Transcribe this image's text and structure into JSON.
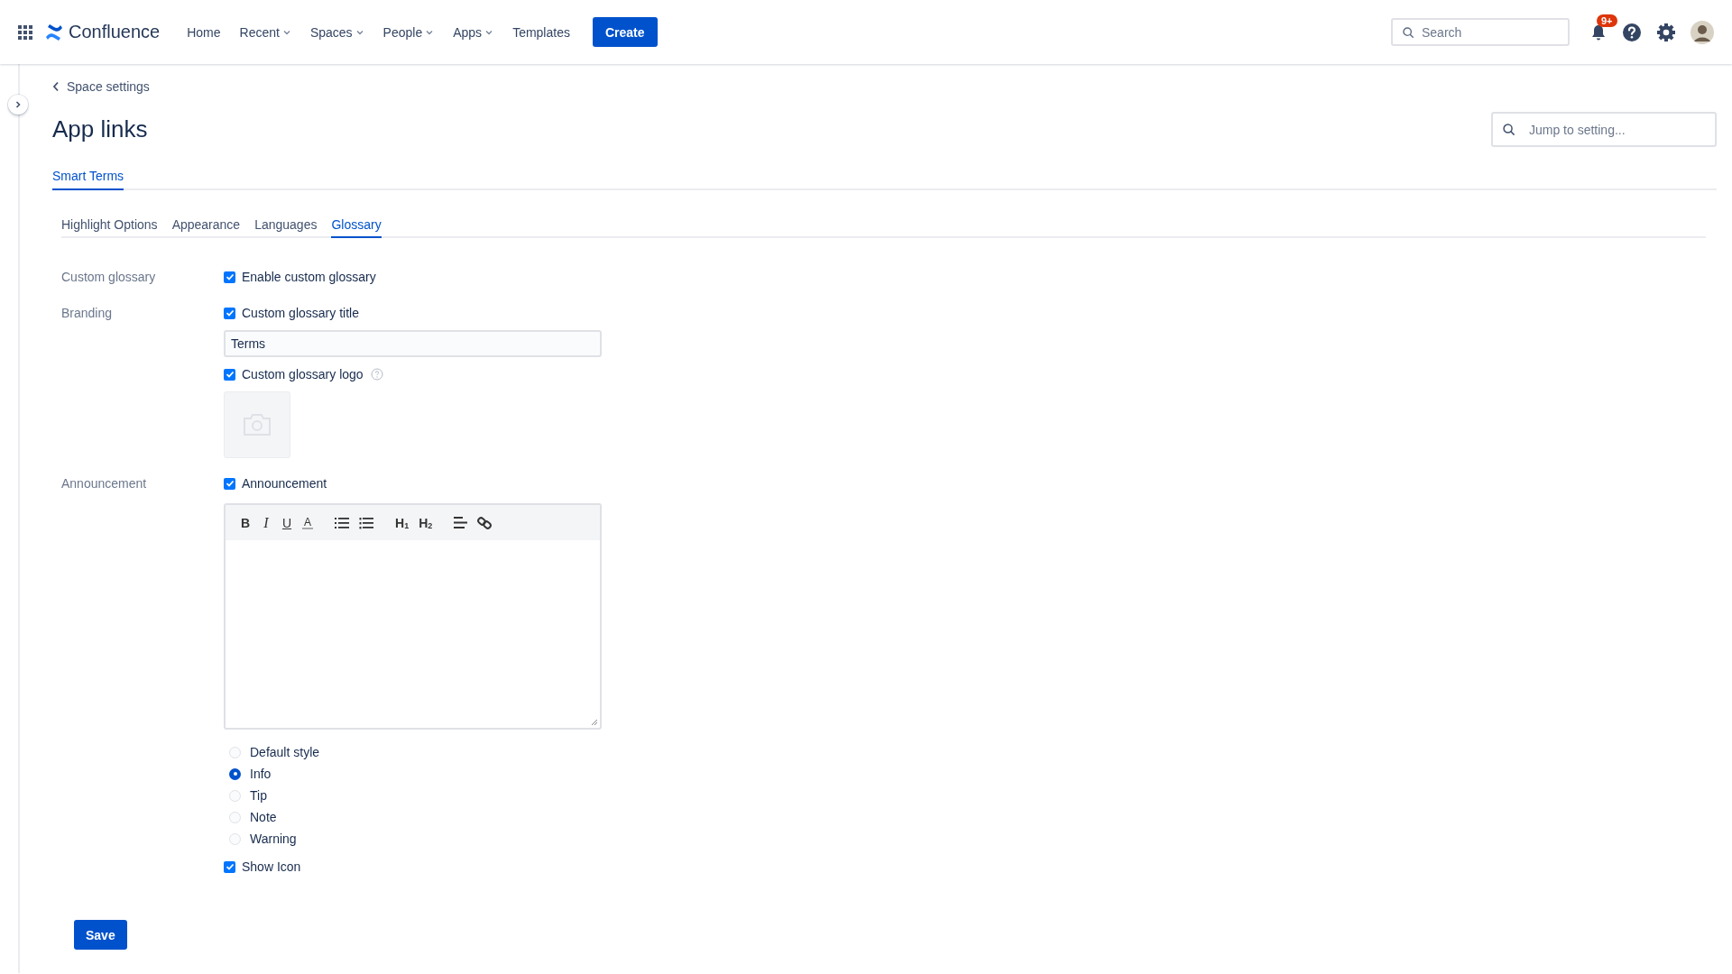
{
  "header": {
    "product": "Confluence",
    "nav": [
      {
        "label": "Home",
        "kind": "link"
      },
      {
        "label": "Recent",
        "kind": "menu"
      },
      {
        "label": "Spaces",
        "kind": "menu"
      },
      {
        "label": "People",
        "kind": "menu"
      },
      {
        "label": "Apps",
        "kind": "menu"
      },
      {
        "label": "Templates",
        "kind": "link"
      }
    ],
    "create_button": "Create",
    "search": {
      "placeholder": "Search"
    },
    "notification_badge": "9+"
  },
  "breadcrumb": "Space settings",
  "page_title": "App links",
  "jump_search": {
    "placeholder": "Jump to setting..."
  },
  "tabs": [
    {
      "label": "Smart Terms",
      "selected": true
    }
  ],
  "subtabs": [
    {
      "label": "Highlight Options",
      "selected": false
    },
    {
      "label": "Appearance",
      "selected": false
    },
    {
      "label": "Languages",
      "selected": false
    },
    {
      "label": "Glossary",
      "selected": true
    }
  ],
  "form": {
    "sections": [
      {
        "label": "Custom glossary",
        "controls": [
          {
            "kind": "checkbox",
            "label": "Enable custom glossary",
            "checked": true
          }
        ]
      },
      {
        "label": "Branding",
        "controls": [
          {
            "kind": "checkbox",
            "label": "Custom glossary title",
            "checked": true
          },
          {
            "kind": "text_input",
            "value": "Terms"
          },
          {
            "kind": "checkbox",
            "label": "Custom glossary logo",
            "checked": true,
            "help": true
          },
          {
            "kind": "logo_upload"
          }
        ]
      },
      {
        "label": "Announcement",
        "controls": [
          {
            "kind": "checkbox",
            "label": "Announcement",
            "checked": true
          },
          {
            "kind": "editor",
            "toolbar": [
              {
                "kind": "bold",
                "label": "B"
              },
              {
                "kind": "italic",
                "label": "I"
              },
              {
                "kind": "underline",
                "label": "U"
              },
              {
                "kind": "color",
                "label": "A"
              },
              {
                "kind": "bullets"
              },
              {
                "kind": "numbers"
              },
              {
                "kind": "heading",
                "label": "H$_{1}$"
              },
              {
                "kind": "heading",
                "label": "H$_{2}$"
              },
              {
                "kind": "align"
              },
              {
                "kind": "link"
              }
            ]
          },
          {
            "kind": "radio_group",
            "options": [
              {
                "label": "Default style",
                "selected": false
              },
              {
                "label": "Info",
                "selected": true
              },
              {
                "label": "Tip",
                "selected": false
              },
              {
                "label": "Note",
                "selected": false
              },
              {
                "label": "Warning",
                "selected": false
              }
            ]
          },
          {
            "kind": "checkbox",
            "label": "Show Icon",
            "checked": true
          }
        ]
      }
    ]
  },
  "save_button": "Save"
}
